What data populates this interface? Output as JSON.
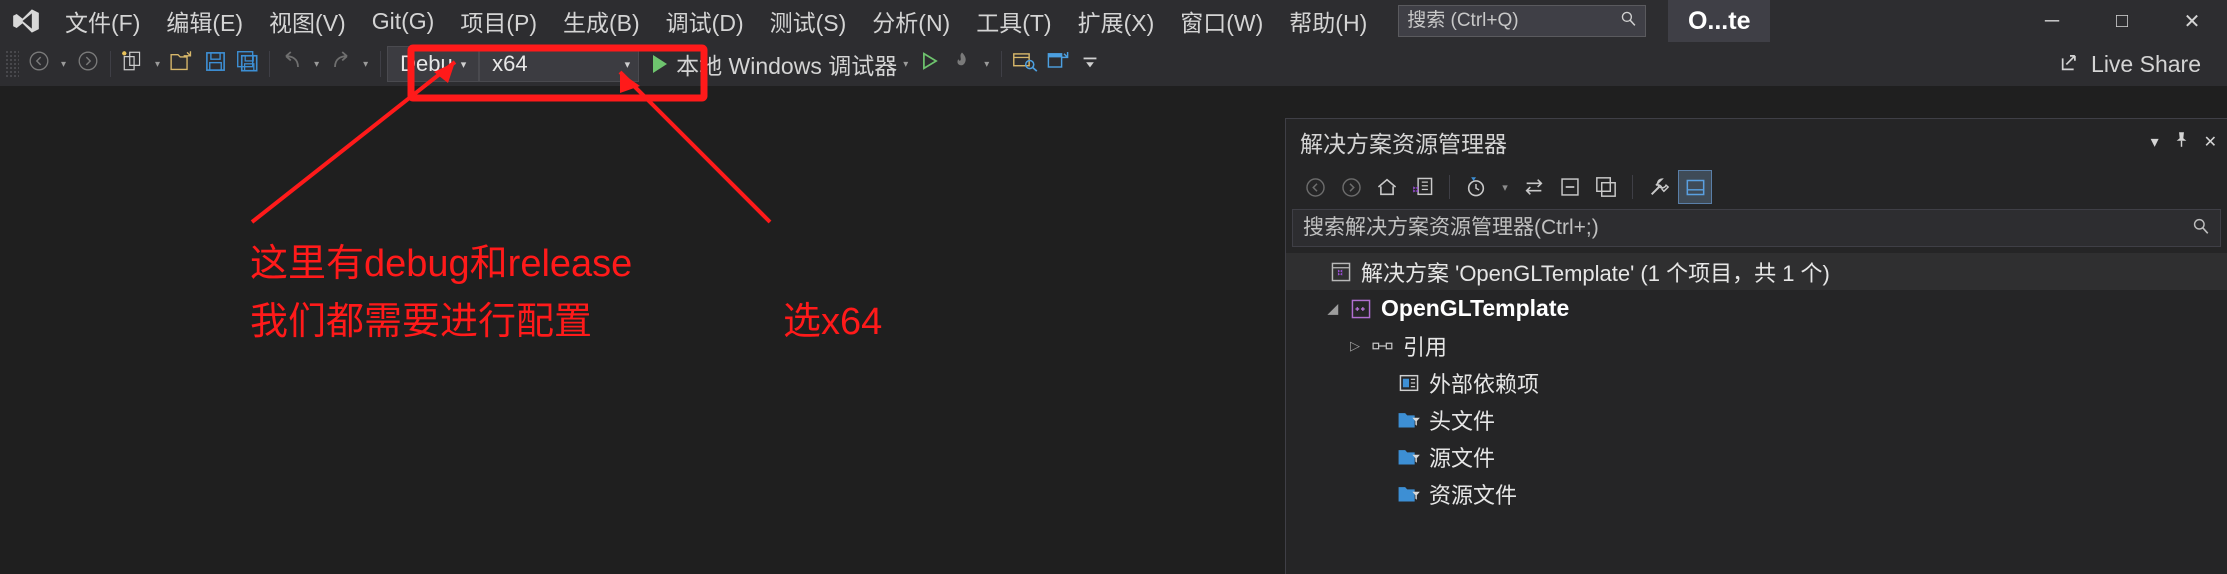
{
  "app": {
    "logo_icon": "visual-studio-logo",
    "document_tab": "O...te"
  },
  "menubar": {
    "items": [
      {
        "label": "文件(F)",
        "accel": "F"
      },
      {
        "label": "编辑(E)",
        "accel": "E"
      },
      {
        "label": "视图(V)",
        "accel": "V"
      },
      {
        "label": "Git(G)",
        "accel": "G"
      },
      {
        "label": "项目(P)",
        "accel": "P"
      },
      {
        "label": "生成(B)",
        "accel": "B"
      },
      {
        "label": "调试(D)",
        "accel": "D"
      },
      {
        "label": "测试(S)",
        "accel": "S"
      },
      {
        "label": "分析(N)",
        "accel": "N"
      },
      {
        "label": "工具(T)",
        "accel": "T"
      },
      {
        "label": "扩展(X)",
        "accel": "X"
      },
      {
        "label": "窗口(W)",
        "accel": "W"
      },
      {
        "label": "帮助(H)",
        "accel": "H"
      }
    ],
    "search_placeholder": "搜索 (Ctrl+Q)",
    "search_value": "",
    "search_icon": "magnifier-icon",
    "window_controls": {
      "minimize": "─",
      "maximize": "□",
      "close": "✕"
    }
  },
  "toolbar": {
    "nav_back_icon": "arrow-back-icon",
    "nav_forward_icon": "arrow-forward-icon",
    "new_item_icon": "new-item-icon",
    "open_file_icon": "open-folder-icon",
    "save_icon": "save-icon",
    "save_all_icon": "save-all-icon",
    "undo_icon": "undo-icon",
    "redo_icon": "redo-icon",
    "config_value": "Debu",
    "platform_value": "x64",
    "run_label": "本地 Windows 调试器",
    "run_play_icon": "play-icon",
    "start_no_debug_icon": "play-outline-icon",
    "hot_reload_icon": "hot-reload-icon",
    "select_window_icon": "select-window-icon",
    "open_preview_icon": "preview-icon",
    "overflow_icon": "toolbar-overflow-icon",
    "live_share_label": "Live Share",
    "live_share_icon": "live-share-icon"
  },
  "solution_explorer": {
    "title": "解决方案资源管理器",
    "header_buttons": {
      "dropdown": "▾",
      "pin": "−",
      "close": "✕"
    },
    "toolbar_icons": [
      "back-icon",
      "forward-icon",
      "home-icon",
      "switch-views-icon",
      "pending-changes-icon",
      "sync-with-active-document-icon",
      "collapse-all-icon",
      "show-all-files-icon",
      "properties-icon",
      "preview-selected-items-icon"
    ],
    "search_placeholder": "搜索解决方案资源管理器(Ctrl+;)",
    "search_value": "",
    "search_icon": "magnifier-icon",
    "tree": [
      {
        "label": "解决方案 'OpenGLTemplate' (1 个项目，共 1 个)",
        "icon": "solution-icon",
        "indent": 0,
        "twisty": "",
        "bold": false,
        "selected": true
      },
      {
        "label": "OpenGLTemplate",
        "icon": "cpp-project-icon",
        "indent": 1,
        "twisty": "◢",
        "bold": true,
        "selected": false
      },
      {
        "label": "引用",
        "icon": "references-icon",
        "indent": 2,
        "twisty": "▷",
        "bold": false,
        "selected": false
      },
      {
        "label": "外部依赖项",
        "icon": "external-dependencies-icon",
        "indent": 3,
        "twisty": "",
        "bold": false,
        "selected": false
      },
      {
        "label": "头文件",
        "icon": "folder-filter-icon",
        "indent": 3,
        "twisty": "",
        "bold": false,
        "selected": false
      },
      {
        "label": "源文件",
        "icon": "folder-filter-icon",
        "indent": 3,
        "twisty": "",
        "bold": false,
        "selected": false
      },
      {
        "label": "资源文件",
        "icon": "folder-filter-icon",
        "indent": 3,
        "twisty": "",
        "bold": false,
        "selected": false
      }
    ]
  },
  "annotations": {
    "color": "#FF1A1A",
    "line1": "这里有debug和release",
    "line2": "我们都需要进行配置",
    "line3": "选x64"
  }
}
